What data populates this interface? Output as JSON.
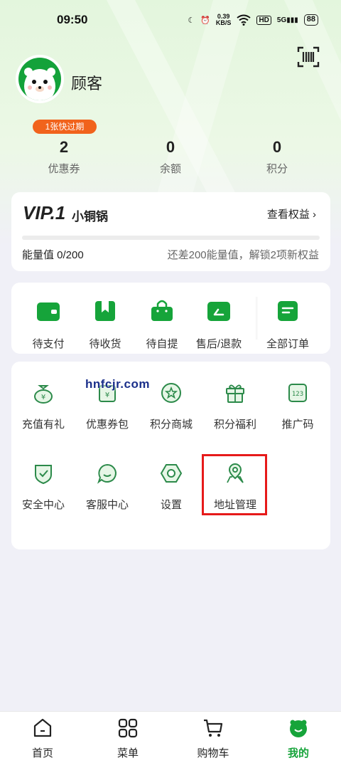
{
  "status_bar": {
    "time": "09:50",
    "net_speed": "0.39",
    "net_unit": "KB/S",
    "hd": "HD",
    "signal": "5G",
    "battery": "88"
  },
  "profile": {
    "name": "顾客",
    "coupon_badge": "1张快过期"
  },
  "stats": [
    {
      "value": "2",
      "label": "优惠券"
    },
    {
      "value": "0",
      "label": "余额"
    },
    {
      "value": "0",
      "label": "积分"
    }
  ],
  "vip": {
    "level": "VIP.1",
    "level_name": "小铜锅",
    "link": "查看权益",
    "energy": "能量值 0/200",
    "energy_progress": 0,
    "hint": "还差200能量值，解锁2项新权益"
  },
  "orders": [
    {
      "label": "待支付",
      "icon": "wallet-icon"
    },
    {
      "label": "待收货",
      "icon": "delivery-icon"
    },
    {
      "label": "待自提",
      "icon": "pickup-bag-icon"
    },
    {
      "label": "售后/退款",
      "icon": "refund-icon"
    },
    {
      "label": "全部订单",
      "icon": "order-list-icon"
    }
  ],
  "services": [
    {
      "label": "充值有礼",
      "icon": "money-bag-icon"
    },
    {
      "label": "优惠券包",
      "icon": "coupon-bag-icon"
    },
    {
      "label": "积分商城",
      "icon": "points-mall-icon"
    },
    {
      "label": "积分福利",
      "icon": "gift-icon"
    },
    {
      "label": "推广码",
      "icon": "promo-code-icon"
    },
    {
      "label": "安全中心",
      "icon": "shield-icon"
    },
    {
      "label": "客服中心",
      "icon": "chat-icon"
    },
    {
      "label": "设置",
      "icon": "settings-icon"
    },
    {
      "label": "地址管理",
      "icon": "location-icon"
    }
  ],
  "watermark": "hnfcjr.com",
  "tabbar": [
    {
      "label": "首页",
      "icon": "home-icon"
    },
    {
      "label": "菜单",
      "icon": "menu-grid-icon"
    },
    {
      "label": "购物车",
      "icon": "cart-icon"
    },
    {
      "label": "我的",
      "icon": "profile-mascot-icon",
      "active": true
    }
  ],
  "colors": {
    "brand_green": "#16a43a",
    "badge_orange": "#f1631c",
    "highlight_red": "#e61a1a"
  }
}
